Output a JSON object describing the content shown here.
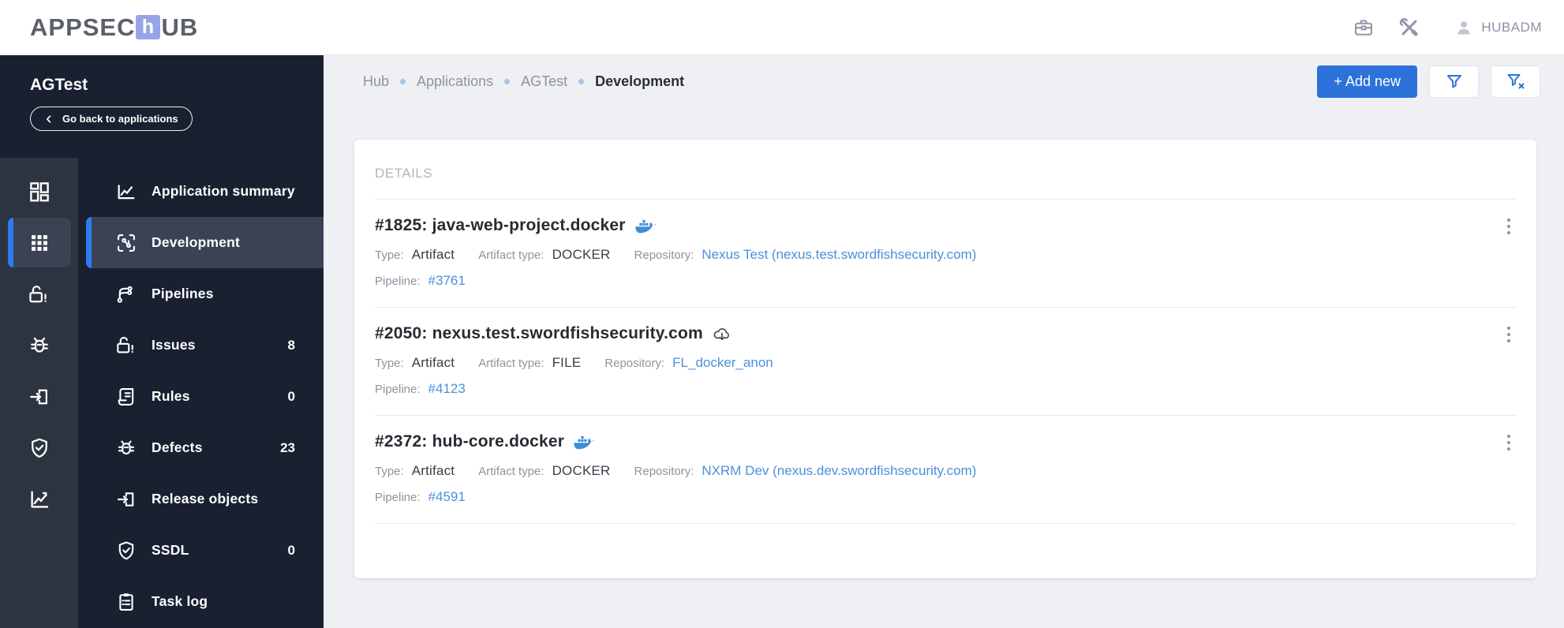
{
  "header": {
    "logo": {
      "part1": "APPSEC",
      "tile": "h",
      "part2": "UB"
    },
    "user": "HUBADM",
    "icons": [
      "briefcase-icon",
      "tools-icon",
      "user-icon"
    ]
  },
  "sidebar": {
    "app_name": "AGTest",
    "back_button": "Go back to applications",
    "rail": [
      {
        "icon": "dashboard-icon",
        "selected": false
      },
      {
        "icon": "apps-grid-icon",
        "selected": true
      },
      {
        "icon": "lock-alert-icon",
        "selected": false
      },
      {
        "icon": "bug-icon",
        "selected": false
      },
      {
        "icon": "exit-icon",
        "selected": false
      },
      {
        "icon": "shield-check-icon",
        "selected": false
      },
      {
        "icon": "chart-icon",
        "selected": false
      }
    ],
    "items": [
      {
        "label": "Application summary",
        "icon": "line-chart-icon",
        "badge": null,
        "selected": false
      },
      {
        "label": "Development",
        "icon": "development-icon",
        "badge": null,
        "selected": true
      },
      {
        "label": "Pipelines",
        "icon": "pipelines-branch-icon",
        "badge": null,
        "selected": false
      },
      {
        "label": "Issues",
        "icon": "lock-alert-icon",
        "badge": "8",
        "selected": false
      },
      {
        "label": "Rules",
        "icon": "scroll-icon",
        "badge": "0",
        "selected": false
      },
      {
        "label": "Defects",
        "icon": "bug-icon",
        "badge": "23",
        "selected": false
      },
      {
        "label": "Release objects",
        "icon": "exit-icon",
        "badge": null,
        "selected": false
      },
      {
        "label": "SSDL",
        "icon": "shield-check-icon",
        "badge": "0",
        "selected": false
      },
      {
        "label": "Task log",
        "icon": "task-log-icon",
        "badge": null,
        "selected": false
      }
    ]
  },
  "breadcrumb": {
    "items": [
      "Hub",
      "Applications",
      "AGTest"
    ],
    "current": "Development"
  },
  "toolbar": {
    "add_new": "+ Add new",
    "filter_icons": [
      "filter-icon",
      "filter-clear-icon"
    ]
  },
  "panel": {
    "title": "DETAILS",
    "labels": {
      "type": "Type:",
      "artifact_type": "Artifact type:",
      "repository": "Repository:",
      "pipeline": "Pipeline:"
    },
    "entries": [
      {
        "title": "#1825: java-web-project.docker",
        "title_icon": "docker-icon",
        "type": "Artifact",
        "artifact_type": "DOCKER",
        "repository": "Nexus Test (nexus.test.swordfishsecurity.com)",
        "pipeline": "#3761"
      },
      {
        "title": "#2050: nexus.test.swordfishsecurity.com",
        "title_icon": "cloud-download-icon",
        "type": "Artifact",
        "artifact_type": "FILE",
        "repository": "FL_docker_anon",
        "pipeline": "#4123"
      },
      {
        "title": "#2372: hub-core.docker",
        "title_icon": "docker-icon",
        "type": "Artifact",
        "artifact_type": "DOCKER",
        "repository": "NXRM Dev (nexus.dev.swordfishsecurity.com)",
        "pipeline": "#4591"
      }
    ]
  },
  "colors": {
    "accent_blue": "#2d72da",
    "selection_blue": "#2e7bf0",
    "sidebar_bg": "#192030",
    "rail_bg": "#2c3440",
    "selected_bg": "#3a4254",
    "link_blue": "#4a90d9",
    "logo_tile": "#98a4e8",
    "main_bg": "#eef0f4",
    "docker_blue": "#3f8ed6"
  }
}
